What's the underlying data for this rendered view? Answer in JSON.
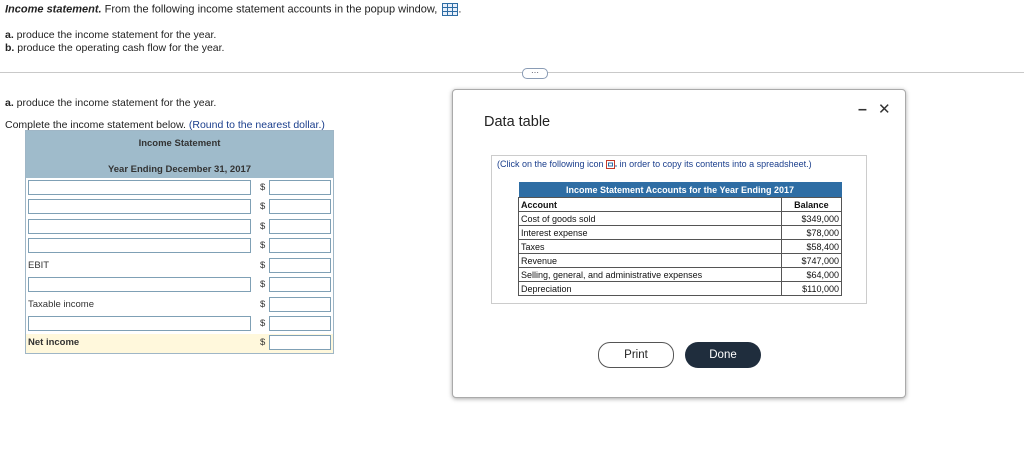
{
  "question": {
    "title_bold": "Income statement.",
    "title_rest": " From the following income statement accounts in the popup window,",
    "title_end": ".",
    "part_a_label": "a.",
    "part_a_text": " produce the income statement for the year.",
    "part_b_label": "b.",
    "part_b_text": " produce the operating cash flow for the year."
  },
  "section_a": {
    "heading_label": "a.",
    "heading_text": " produce the income statement for the year.",
    "instruction": "Complete the income statement below. ",
    "note": "(Round to the nearest dollar.)"
  },
  "income_statement": {
    "title": "Income Statement",
    "period": "Year Ending December 31, 2017",
    "dollar_sign": "$",
    "rows": [
      {
        "label": ""
      },
      {
        "label": ""
      },
      {
        "label": ""
      },
      {
        "label": ""
      },
      {
        "label": "EBIT"
      },
      {
        "label": ""
      },
      {
        "label": "Taxable income"
      },
      {
        "label": ""
      },
      {
        "label": "Net income"
      }
    ]
  },
  "popup": {
    "title": "Data table",
    "minimize": "–",
    "close": "✕",
    "hint_before": "(Click on the following icon ",
    "hint_after": " in order to copy its contents into a spreadsheet.)",
    "table_caption": "Income Statement Accounts for the Year Ending 2017",
    "col_account": "Account",
    "col_balance": "Balance",
    "accounts": [
      {
        "name": "Cost of goods sold",
        "balance": "$349,000"
      },
      {
        "name": "Interest expense",
        "balance": "$78,000"
      },
      {
        "name": "Taxes",
        "balance": "$58,400"
      },
      {
        "name": "Revenue",
        "balance": "$747,000"
      },
      {
        "name": "Selling, general, and administrative expenses",
        "balance": "$64,000"
      },
      {
        "name": "Depreciation",
        "balance": "$110,000"
      }
    ],
    "print_label": "Print",
    "done_label": "Done"
  },
  "expand_glyph": "⋯",
  "colors": {
    "accent": "#2e6da4",
    "header_bg": "#9fbbcb",
    "done_bg": "#1f2d3d",
    "net_bg": "#fff8dc"
  }
}
